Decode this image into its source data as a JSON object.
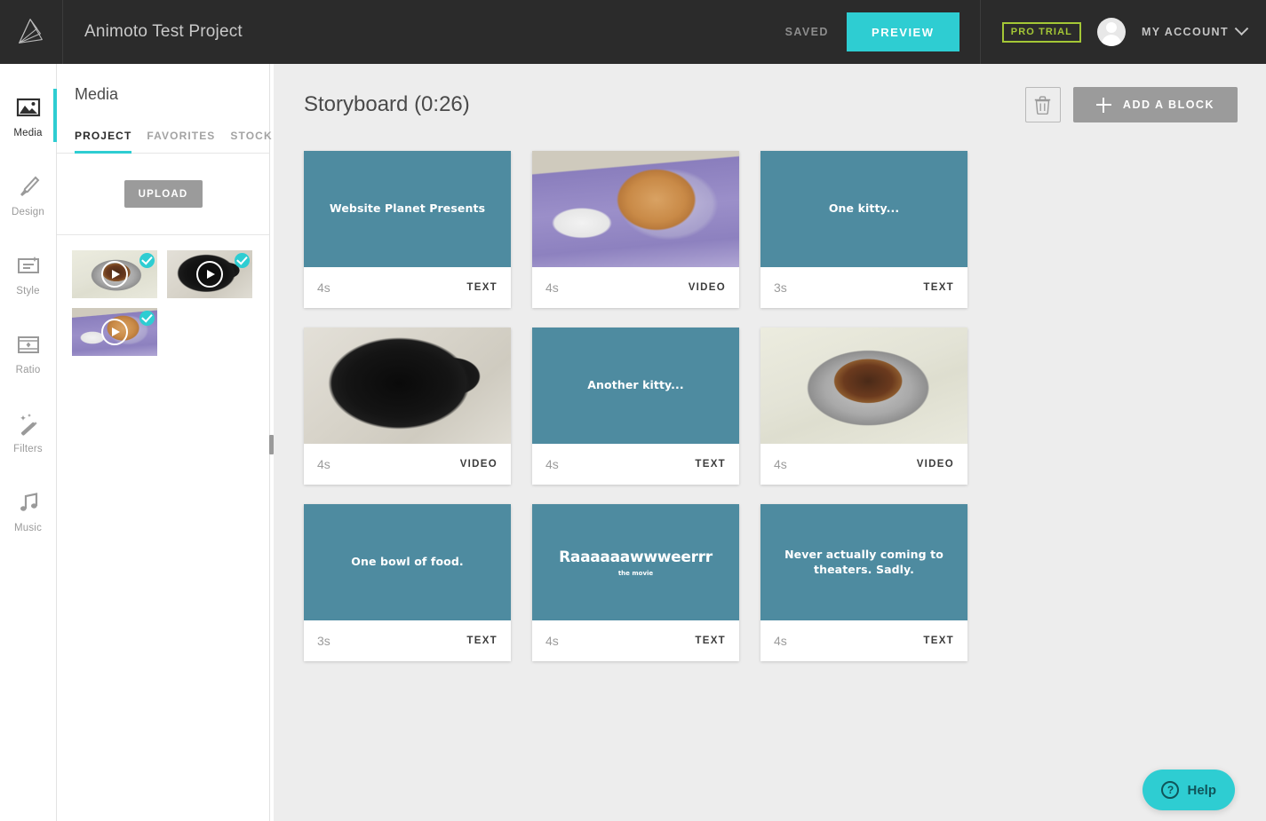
{
  "topbar": {
    "logo_icon": "animoto-logo-icon",
    "project_title": "Animoto Test Project",
    "saved_label": "SAVED",
    "preview_label": "PREVIEW",
    "pro_trial_label": "PRO TRIAL",
    "account_label": "MY ACCOUNT",
    "accent_color": "#2ecdd2",
    "pro_trial_color": "#a4c736",
    "background_color": "#2b2b2b"
  },
  "rail": {
    "items": [
      {
        "label": "Media",
        "icon": "image-icon",
        "active": true
      },
      {
        "label": "Design",
        "icon": "paintbrush-icon",
        "active": false
      },
      {
        "label": "Style",
        "icon": "text-style-icon",
        "active": false
      },
      {
        "label": "Ratio",
        "icon": "aspect-ratio-icon",
        "active": false
      },
      {
        "label": "Filters",
        "icon": "magic-wand-icon",
        "active": false
      },
      {
        "label": "Music",
        "icon": "music-note-icon",
        "active": false
      }
    ]
  },
  "panel": {
    "title": "Media",
    "tabs": [
      {
        "label": "PROJECT",
        "active": true
      },
      {
        "label": "FAVORITES",
        "active": false
      },
      {
        "label": "STOCK",
        "active": false
      }
    ],
    "upload_label": "UPLOAD",
    "thumbnails": [
      {
        "name": "media-thumb-food-bowl",
        "style": "img-bowl",
        "selected": true,
        "play": true
      },
      {
        "name": "media-thumb-black-cat",
        "style": "img-blackcat",
        "selected": true,
        "play": true
      },
      {
        "name": "media-thumb-cone-cat",
        "style": "img-conecat",
        "selected": true,
        "play": true
      }
    ]
  },
  "board": {
    "title": "Storyboard (0:26)",
    "trash_icon": "trash-icon",
    "add_block_label": "ADD A BLOCK",
    "text_block_color": "#4e8ba0",
    "cards": [
      {
        "kind": "text",
        "title": "Website Planet Presents",
        "subtitle": "",
        "duration": "4s",
        "type": "TEXT",
        "big": false,
        "image": ""
      },
      {
        "kind": "video",
        "title": "",
        "subtitle": "",
        "duration": "4s",
        "type": "VIDEO",
        "big": false,
        "image": "img-conecat"
      },
      {
        "kind": "text",
        "title": "One kitty...",
        "subtitle": "",
        "duration": "3s",
        "type": "TEXT",
        "big": false,
        "image": ""
      },
      {
        "kind": "video",
        "title": "",
        "subtitle": "",
        "duration": "4s",
        "type": "VIDEO",
        "big": false,
        "image": "img-blackcat"
      },
      {
        "kind": "text",
        "title": "Another kitty...",
        "subtitle": "",
        "duration": "4s",
        "type": "TEXT",
        "big": false,
        "image": ""
      },
      {
        "kind": "video",
        "title": "",
        "subtitle": "",
        "duration": "4s",
        "type": "VIDEO",
        "big": false,
        "image": "img-bowl"
      },
      {
        "kind": "text",
        "title": "One bowl of food.",
        "subtitle": "",
        "duration": "3s",
        "type": "TEXT",
        "big": false,
        "image": ""
      },
      {
        "kind": "text",
        "title": "Raaaaaawwweerrr",
        "subtitle": "the movie",
        "duration": "4s",
        "type": "TEXT",
        "big": true,
        "image": ""
      },
      {
        "kind": "text",
        "title": "Never actually coming to theaters. Sadly.",
        "subtitle": "",
        "duration": "4s",
        "type": "TEXT",
        "big": false,
        "image": ""
      }
    ]
  },
  "help": {
    "label": "Help",
    "icon": "question-mark-icon"
  }
}
